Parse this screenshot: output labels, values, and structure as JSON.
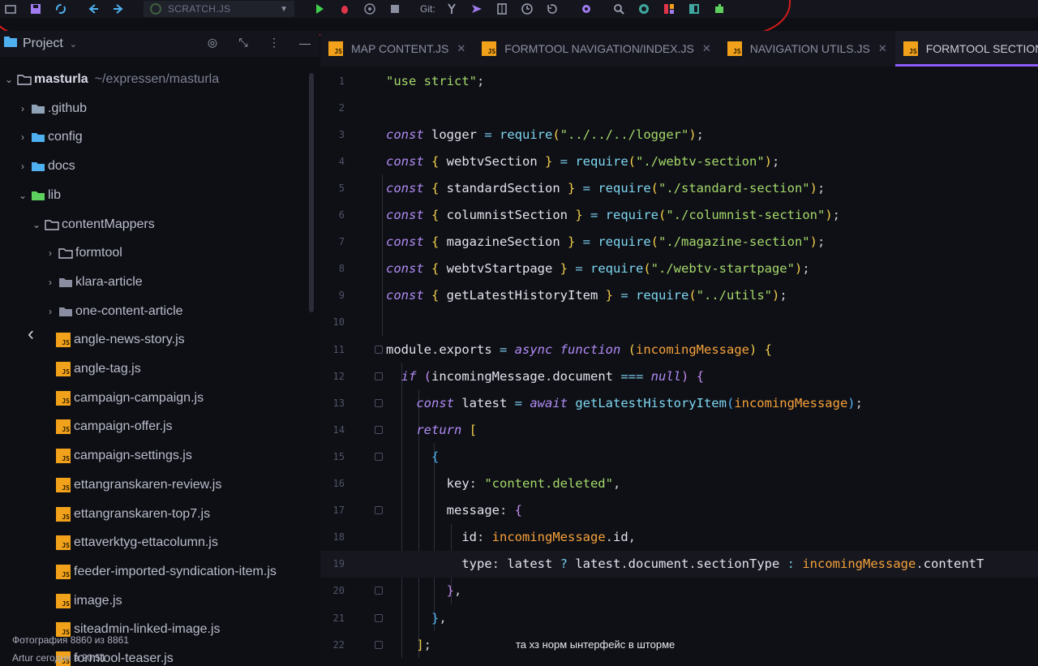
{
  "toolbar": {
    "run_config": "SCRATCH.JS",
    "git_label": "Git:",
    "icons": [
      "folder-icon",
      "save-icon",
      "sync-icon",
      "back-icon",
      "forward-icon",
      "run-icon",
      "debug-icon",
      "coverage-icon",
      "stop-icon",
      "git-branch-icon",
      "git-push-icon",
      "git-compare-icon",
      "history-icon",
      "rollback-icon",
      "settings-icon",
      "search-icon",
      "inspect-icon",
      "structure-icon",
      "sidebar-icon",
      "plugin-icon"
    ]
  },
  "project_panel": {
    "title": "Project",
    "root_name": "masturla",
    "root_path": "~/expressen/masturla",
    "items": [
      {
        "label": "masturla",
        "kind": "root",
        "level": 0,
        "expanded": true
      },
      {
        "label": ".github",
        "kind": "folder",
        "level": 1,
        "expanded": false
      },
      {
        "label": "config",
        "kind": "folder",
        "level": 1,
        "expanded": false
      },
      {
        "label": "docs",
        "kind": "folder",
        "level": 1,
        "expanded": false
      },
      {
        "label": "lib",
        "kind": "folder",
        "level": 1,
        "expanded": true
      },
      {
        "label": "contentMappers",
        "kind": "folder",
        "level": 2,
        "expanded": true
      },
      {
        "label": "formtool",
        "kind": "folder",
        "level": 3,
        "expanded": false
      },
      {
        "label": "klara-article",
        "kind": "folder",
        "level": 3,
        "expanded": false
      },
      {
        "label": "one-content-article",
        "kind": "folder",
        "level": 3,
        "expanded": false
      },
      {
        "label": "angle-news-story.js",
        "kind": "js",
        "level": 3
      },
      {
        "label": "angle-tag.js",
        "kind": "js",
        "level": 3
      },
      {
        "label": "campaign-campaign.js",
        "kind": "js",
        "level": 3
      },
      {
        "label": "campaign-offer.js",
        "kind": "js",
        "level": 3
      },
      {
        "label": "campaign-settings.js",
        "kind": "js",
        "level": 3
      },
      {
        "label": "ettangranskaren-review.js",
        "kind": "js",
        "level": 3
      },
      {
        "label": "ettangranskaren-top7.js",
        "kind": "js",
        "level": 3
      },
      {
        "label": "ettaverktyg-ettacolumn.js",
        "kind": "js",
        "level": 3
      },
      {
        "label": "feeder-imported-syndication-item.js",
        "kind": "js",
        "level": 3
      },
      {
        "label": "image.js",
        "kind": "js",
        "level": 3
      },
      {
        "label": "siteadmin-linked-image.js",
        "kind": "js",
        "level": 3
      },
      {
        "label": "formtool-teaser.js",
        "kind": "js",
        "level": 3
      }
    ]
  },
  "tabs": [
    {
      "label": "MAP CONTENT.JS",
      "active": false
    },
    {
      "label": "FORMTOOL NAVIGATION/INDEX.JS",
      "active": false
    },
    {
      "label": "NAVIGATION UTILS.JS",
      "active": false
    },
    {
      "label": "FORMTOOL SECTION/IN",
      "active": true
    }
  ],
  "editor": {
    "current_line": 19,
    "lines": [
      {
        "n": "1",
        "tokens": [
          [
            "str",
            "\"use strict\""
          ],
          [
            "punc",
            ";"
          ]
        ]
      },
      {
        "n": "2",
        "tokens": []
      },
      {
        "n": "3",
        "tokens": [
          [
            "kw",
            "const"
          ],
          [
            "var",
            " logger "
          ],
          [
            "op",
            "="
          ],
          [
            "fn",
            " require"
          ],
          [
            "br",
            "("
          ],
          [
            "str",
            "\"../../../logger\""
          ],
          [
            "br",
            ")"
          ],
          [
            "punc",
            ";"
          ]
        ]
      },
      {
        "n": "4",
        "tokens": [
          [
            "kw",
            "const"
          ],
          [
            "br",
            " {"
          ],
          [
            "var",
            " webtvSection "
          ],
          [
            "br",
            "}"
          ],
          [
            "op",
            " ="
          ],
          [
            "fn",
            " require"
          ],
          [
            "br",
            "("
          ],
          [
            "str",
            "\"./webtv-section\""
          ],
          [
            "br",
            ")"
          ],
          [
            "punc",
            ";"
          ]
        ]
      },
      {
        "n": "5",
        "tokens": [
          [
            "kw",
            "const"
          ],
          [
            "br",
            " {"
          ],
          [
            "var",
            " standardSection "
          ],
          [
            "br",
            "}"
          ],
          [
            "op",
            " ="
          ],
          [
            "fn",
            " require"
          ],
          [
            "br",
            "("
          ],
          [
            "str",
            "\"./standard-section\""
          ],
          [
            "br",
            ")"
          ],
          [
            "punc",
            ";"
          ]
        ]
      },
      {
        "n": "6",
        "tokens": [
          [
            "kw",
            "const"
          ],
          [
            "br",
            " {"
          ],
          [
            "var",
            " columnistSection "
          ],
          [
            "br",
            "}"
          ],
          [
            "op",
            " ="
          ],
          [
            "fn",
            " require"
          ],
          [
            "br",
            "("
          ],
          [
            "str",
            "\"./columnist-section\""
          ],
          [
            "br",
            ")"
          ],
          [
            "punc",
            ";"
          ]
        ]
      },
      {
        "n": "7",
        "tokens": [
          [
            "kw",
            "const"
          ],
          [
            "br",
            " {"
          ],
          [
            "var",
            " magazineSection "
          ],
          [
            "br",
            "}"
          ],
          [
            "op",
            " ="
          ],
          [
            "fn",
            " require"
          ],
          [
            "br",
            "("
          ],
          [
            "str",
            "\"./magazine-section\""
          ],
          [
            "br",
            ")"
          ],
          [
            "punc",
            ";"
          ]
        ]
      },
      {
        "n": "8",
        "tokens": [
          [
            "kw",
            "const"
          ],
          [
            "br",
            " {"
          ],
          [
            "var",
            " webtvStartpage "
          ],
          [
            "br",
            "}"
          ],
          [
            "op",
            " ="
          ],
          [
            "fn",
            " require"
          ],
          [
            "br",
            "("
          ],
          [
            "str",
            "\"./webtv-startpage\""
          ],
          [
            "br",
            ")"
          ],
          [
            "punc",
            ";"
          ]
        ]
      },
      {
        "n": "9",
        "tokens": [
          [
            "kw",
            "const"
          ],
          [
            "br",
            " {"
          ],
          [
            "var",
            " getLatestHistoryItem "
          ],
          [
            "br",
            "}"
          ],
          [
            "op",
            " ="
          ],
          [
            "fn",
            " require"
          ],
          [
            "br",
            "("
          ],
          [
            "str",
            "\"../utils\""
          ],
          [
            "br",
            ")"
          ],
          [
            "punc",
            ";"
          ]
        ]
      },
      {
        "n": "10",
        "tokens": []
      },
      {
        "n": "11",
        "tokens": [
          [
            "var",
            "module"
          ],
          [
            "punc",
            "."
          ],
          [
            "var",
            "exports "
          ],
          [
            "op",
            "="
          ],
          [
            "kw",
            " async function "
          ],
          [
            "br",
            "("
          ],
          [
            "param",
            "incomingMessage"
          ],
          [
            "br",
            ")"
          ],
          [
            "br",
            " {"
          ]
        ]
      },
      {
        "n": "12",
        "tokens": [
          [
            "var",
            "  "
          ],
          [
            "kw",
            "if"
          ],
          [
            "br2",
            " ("
          ],
          [
            "var",
            "incomingMessage"
          ],
          [
            "punc",
            "."
          ],
          [
            "var",
            "document "
          ],
          [
            "op",
            "==="
          ],
          [
            "kw",
            " null"
          ],
          [
            "br2",
            ")"
          ],
          [
            "br2",
            " {"
          ]
        ]
      },
      {
        "n": "13",
        "tokens": [
          [
            "var",
            "    "
          ],
          [
            "kw",
            "const"
          ],
          [
            "var",
            " latest "
          ],
          [
            "op",
            "="
          ],
          [
            "kw",
            " await"
          ],
          [
            "fn",
            " getLatestHistoryItem"
          ],
          [
            "br3",
            "("
          ],
          [
            "param",
            "incomingMessage"
          ],
          [
            "br3",
            ")"
          ],
          [
            "punc",
            ";"
          ]
        ]
      },
      {
        "n": "14",
        "tokens": [
          [
            "var",
            "    "
          ],
          [
            "kw",
            "return"
          ],
          [
            "br",
            " ["
          ]
        ]
      },
      {
        "n": "15",
        "tokens": [
          [
            "var",
            "      "
          ],
          [
            "br3",
            "{"
          ]
        ]
      },
      {
        "n": "16",
        "tokens": [
          [
            "var",
            "        "
          ],
          [
            "prop",
            "key"
          ],
          [
            "punc",
            ": "
          ],
          [
            "str",
            "\"content.deleted\""
          ],
          [
            "punc",
            ","
          ]
        ]
      },
      {
        "n": "17",
        "tokens": [
          [
            "var",
            "        "
          ],
          [
            "prop",
            "message"
          ],
          [
            "punc",
            ": "
          ],
          [
            "br2",
            "{"
          ]
        ]
      },
      {
        "n": "18",
        "tokens": [
          [
            "var",
            "          "
          ],
          [
            "prop",
            "id"
          ],
          [
            "punc",
            ": "
          ],
          [
            "param",
            "incomingMessage"
          ],
          [
            "punc",
            "."
          ],
          [
            "var",
            "id"
          ],
          [
            "punc",
            ","
          ]
        ]
      },
      {
        "n": "19",
        "tokens": [
          [
            "var",
            "          "
          ],
          [
            "prop",
            "type"
          ],
          [
            "punc",
            ": "
          ],
          [
            "var",
            "latest "
          ],
          [
            "op",
            "?"
          ],
          [
            "var",
            " latest"
          ],
          [
            "punc",
            "."
          ],
          [
            "var",
            "document"
          ],
          [
            "punc",
            "."
          ],
          [
            "var",
            "sectionType "
          ],
          [
            "op",
            ":"
          ],
          [
            "param",
            " incomingMessage"
          ],
          [
            "punc",
            "."
          ],
          [
            "var",
            "contentT"
          ]
        ]
      },
      {
        "n": "20",
        "tokens": [
          [
            "var",
            "        "
          ],
          [
            "br2",
            "}"
          ],
          [
            "punc",
            ","
          ]
        ]
      },
      {
        "n": "21",
        "tokens": [
          [
            "var",
            "      "
          ],
          [
            "br3",
            "}"
          ],
          [
            "punc",
            ","
          ]
        ]
      },
      {
        "n": "22",
        "tokens": [
          [
            "var",
            "    "
          ],
          [
            "br",
            "]"
          ],
          [
            "punc",
            ";"
          ]
        ]
      }
    ]
  },
  "overlay": {
    "photo_counter": "Фотография 8860 из 8861",
    "author_line": "Artur   сегодня в 20:51",
    "caption": "та хз норм ынтерфейс в шторме"
  },
  "colors": {
    "accent": "#8b5cf6",
    "annotation_red": "#d41c1c",
    "js_icon": "#f1a11a"
  }
}
